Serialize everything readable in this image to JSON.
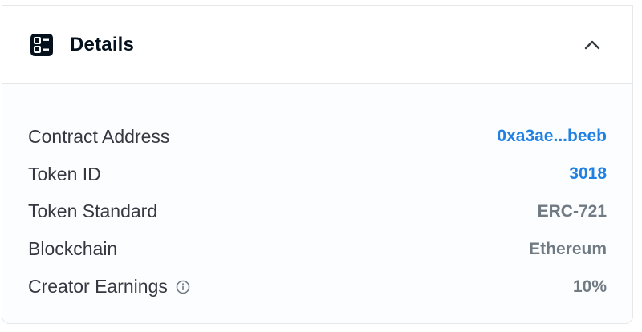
{
  "panel": {
    "title": "Details",
    "header_icon": "details-grid-icon",
    "toggle_icon": "chevron-up-icon"
  },
  "rows": [
    {
      "label": "Contract Address",
      "value": "0xa3ae...beeb",
      "link": true
    },
    {
      "label": "Token ID",
      "value": "3018",
      "link": true
    },
    {
      "label": "Token Standard",
      "value": "ERC-721",
      "link": false
    },
    {
      "label": "Blockchain",
      "value": "Ethereum",
      "link": false
    },
    {
      "label": "Creator Earnings",
      "value": "10%",
      "link": false,
      "info_icon": "info-icon"
    }
  ],
  "colors": {
    "link": "#2081e2",
    "label": "#353840",
    "value": "#707a83",
    "title": "#04111d"
  }
}
